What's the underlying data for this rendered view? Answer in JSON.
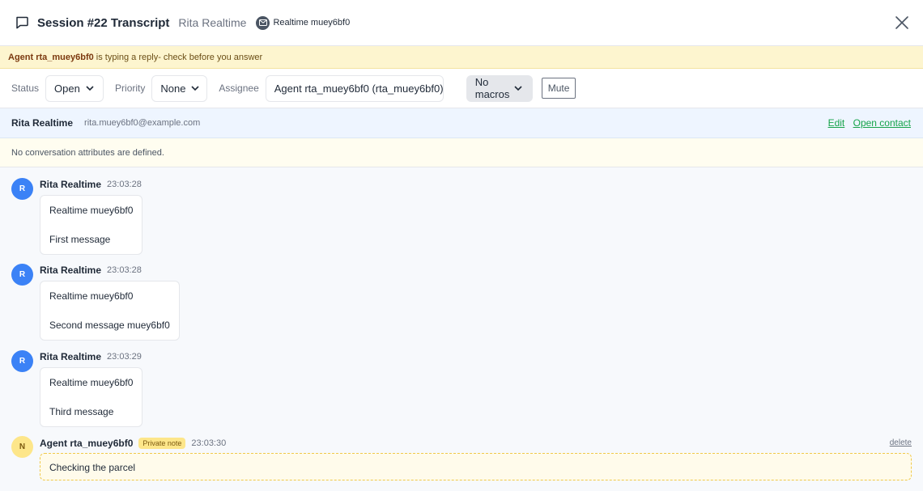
{
  "header": {
    "title": "Session #22 Transcript",
    "contact_name": "Rita Realtime",
    "channel_label": "Realtime muey6bf0"
  },
  "typing_banner": {
    "agent": "Agent rta_muey6bf0",
    "text": "is typing a reply- check before you answer"
  },
  "toolbar": {
    "status_label": "Status",
    "status_value": "Open",
    "priority_label": "Priority",
    "priority_value": "None",
    "assignee_label": "Assignee",
    "assignee_value": "Agent rta_muey6bf0 (rta_muey6bf0)",
    "macros_value": "No macros",
    "mute_label": "Mute"
  },
  "contact": {
    "name": "Rita Realtime",
    "email": "rita.muey6bf0@example.com",
    "edit_label": "Edit",
    "open_contact_label": "Open contact"
  },
  "attributes": {
    "empty_text": "No conversation attributes are defined."
  },
  "messages": [
    {
      "initial": "R",
      "author": "Rita Realtime",
      "time": "23:03:28",
      "lines": [
        "Realtime muey6bf0",
        "First message"
      ]
    },
    {
      "initial": "R",
      "author": "Rita Realtime",
      "time": "23:03:28",
      "lines": [
        "Realtime muey6bf0",
        "Second message muey6bf0"
      ]
    },
    {
      "initial": "R",
      "author": "Rita Realtime",
      "time": "23:03:29",
      "lines": [
        "Realtime muey6bf0",
        "Third message"
      ]
    }
  ],
  "note": {
    "initial": "N",
    "author": "Agent rta_muey6bf0",
    "badge": "Private note",
    "time": "23:03:30",
    "text": "Checking the parcel",
    "delete_label": "delete"
  },
  "colors": {
    "accent_link": "#16a34a",
    "avatar_blue": "#3b82f6",
    "note_yellow": "#fde68a",
    "typing_bg": "#fdf5cf"
  }
}
